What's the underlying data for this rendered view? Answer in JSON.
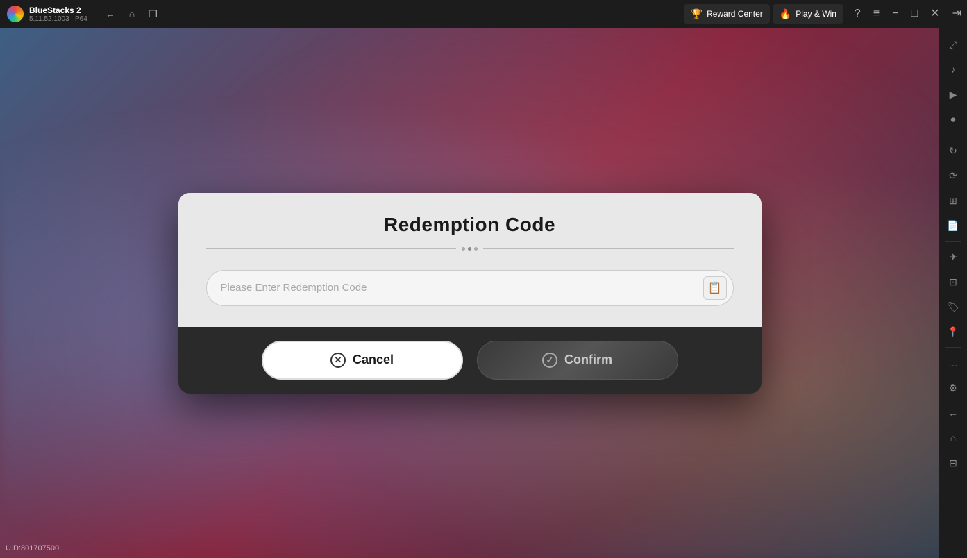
{
  "app": {
    "name": "BlueStacks 2",
    "version": "5.11.52.1003",
    "arch": "P64"
  },
  "topbar": {
    "nav": {
      "back_label": "←",
      "home_label": "⌂",
      "copy_label": "❐"
    },
    "reward_center_label": "Reward Center",
    "play_win_label": "Play & Win",
    "help_icon": "?",
    "menu_icon": "≡",
    "minimize_icon": "−",
    "restore_icon": "❐",
    "close_icon": "✕",
    "expand_icon": "⇥"
  },
  "sidebar": {
    "icons": [
      {
        "name": "expand-icon",
        "symbol": "⤢"
      },
      {
        "name": "volume-icon",
        "symbol": "🔊"
      },
      {
        "name": "video-icon",
        "symbol": "▶"
      },
      {
        "name": "camera-icon",
        "symbol": "📷"
      },
      {
        "name": "rotate-icon",
        "symbol": "↻"
      },
      {
        "name": "refresh-icon",
        "symbol": "⟳"
      },
      {
        "name": "layers-icon",
        "symbol": "⊞"
      },
      {
        "name": "docs-icon",
        "symbol": "📄"
      },
      {
        "name": "plane-icon",
        "symbol": "✈"
      },
      {
        "name": "compress-icon",
        "symbol": "⊡"
      },
      {
        "name": "tag-icon",
        "symbol": "🏷"
      },
      {
        "name": "location-icon",
        "symbol": "📍"
      },
      {
        "name": "more-icon",
        "symbol": "…"
      },
      {
        "name": "settings-icon",
        "symbol": "⚙"
      },
      {
        "name": "back-icon",
        "symbol": "←"
      },
      {
        "name": "home-icon",
        "symbol": "⌂"
      },
      {
        "name": "pages-icon",
        "symbol": "⊟"
      }
    ]
  },
  "dialog": {
    "title": "Redemption Code",
    "input_placeholder": "Please Enter Redemption Code",
    "paste_icon": "📋",
    "cancel_label": "Cancel",
    "confirm_label": "Confirm",
    "cancel_icon": "✕",
    "confirm_icon": "✓"
  },
  "uid": {
    "label": "UID:801707500"
  }
}
